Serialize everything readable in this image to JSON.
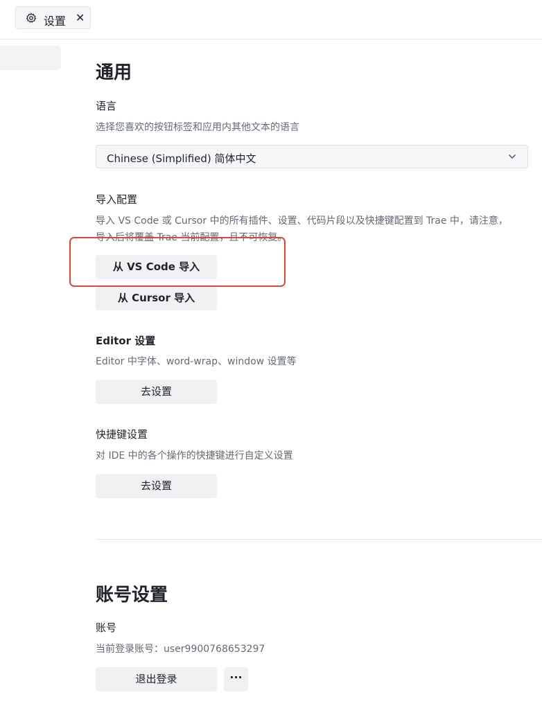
{
  "tab": {
    "label": "设置",
    "close": "✕",
    "icon": "gear-icon"
  },
  "general": {
    "title": "通用",
    "language": {
      "label": "语言",
      "desc": "选择您喜欢的按钮标签和应用内其他文本的语言",
      "value": "Chinese (Simplified) 简体中文"
    },
    "import": {
      "label": "导入配置",
      "desc_line1": "导入 VS Code 或 Cursor 中的所有插件、设置、代码片段以及快捷键配置到 Trae 中，请注意，",
      "desc_line2": "导入后将覆盖 Trae 当前配置，且不可恢复。",
      "vscode_button": "从 VS Code 导入",
      "cursor_button": "从 Cursor 导入"
    },
    "editor": {
      "label": "Editor 设置",
      "desc": "Editor 中字体、word-wrap、window 设置等",
      "button": "去设置"
    },
    "shortcuts": {
      "label": "快捷键设置",
      "desc": "对 IDE 中的各个操作的快捷键进行自定义设置",
      "button": "去设置"
    }
  },
  "account": {
    "title": "账号设置",
    "label": "账号",
    "current": "当前登录账号：user9900768653297",
    "logout_button": "退出登录",
    "more_button": "···"
  },
  "colors": {
    "highlight": "#d9473d",
    "button_bg": "#f0f1f3"
  }
}
